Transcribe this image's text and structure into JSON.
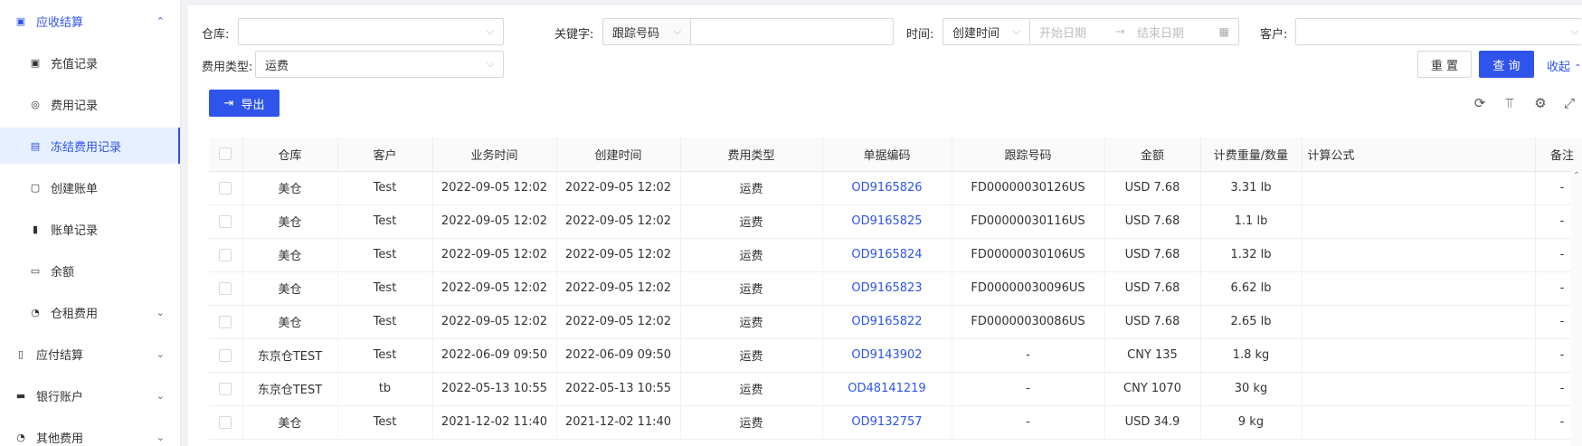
{
  "sidebar": {
    "items": [
      {
        "icon": "ticket-icon",
        "glyph": "▣",
        "label": "应收结算",
        "level": "top",
        "arrow": "⌃",
        "state": "open"
      },
      {
        "icon": "ticket-icon",
        "glyph": "▣",
        "label": "充值记录",
        "level": "sub",
        "arrow": "",
        "state": ""
      },
      {
        "icon": "coin-icon",
        "glyph": "◎",
        "label": "费用记录",
        "level": "sub",
        "arrow": "",
        "state": ""
      },
      {
        "icon": "freeze-icon",
        "glyph": "▤",
        "label": "冻结费用记录",
        "level": "sub",
        "arrow": "",
        "state": "active"
      },
      {
        "icon": "bill-icon",
        "glyph": "▢",
        "label": "创建账单",
        "level": "sub",
        "arrow": "",
        "state": ""
      },
      {
        "icon": "record-icon",
        "glyph": "▮",
        "label": "账单记录",
        "level": "sub",
        "arrow": "",
        "state": ""
      },
      {
        "icon": "balance-icon",
        "glyph": "▭",
        "label": "余额",
        "level": "sub",
        "arrow": "",
        "state": ""
      },
      {
        "icon": "rent-icon",
        "glyph": "◔",
        "label": "仓租费用",
        "level": "sub",
        "arrow": "⌄",
        "state": ""
      },
      {
        "icon": "payable-icon",
        "glyph": "▯",
        "label": "应付结算",
        "level": "top",
        "arrow": "⌄",
        "state": ""
      },
      {
        "icon": "bank-icon",
        "glyph": "▬",
        "label": "银行账户",
        "level": "top",
        "arrow": "⌄",
        "state": ""
      },
      {
        "icon": "other-fee-icon",
        "glyph": "◔",
        "label": "其他费用",
        "level": "top",
        "arrow": "⌄",
        "state": ""
      }
    ]
  },
  "filters": {
    "warehouse_label": "仓库:",
    "keyword_label": "关键字:",
    "keyword_type": "跟踪号码",
    "time_label": "时间:",
    "time_type": "创建时间",
    "start_placeholder": "开始日期",
    "end_placeholder": "结束日期",
    "date_arrow": "→",
    "customer_label": "客户:",
    "fee_type_label": "费用类型:",
    "fee_type_value": "运费",
    "reset": "重 置",
    "query": "查 询",
    "collapse": "收起"
  },
  "toolbar": {
    "export": "导出"
  },
  "table": {
    "columns": [
      "仓库",
      "客户",
      "业务时间",
      "创建时间",
      "费用类型",
      "单据编码",
      "跟踪号码",
      "金额",
      "计费重量/数量",
      "计算公式",
      "备注"
    ],
    "rows": [
      [
        "美仓",
        "Test",
        "2022-09-05 12:02",
        "2022-09-05 12:02",
        "运费",
        "OD9165826",
        "FD00000030126US",
        "USD 7.68",
        "3.31 lb",
        "",
        "-"
      ],
      [
        "美仓",
        "Test",
        "2022-09-05 12:02",
        "2022-09-05 12:02",
        "运费",
        "OD9165825",
        "FD00000030116US",
        "USD 7.68",
        "1.1 lb",
        "",
        "-"
      ],
      [
        "美仓",
        "Test",
        "2022-09-05 12:02",
        "2022-09-05 12:02",
        "运费",
        "OD9165824",
        "FD00000030106US",
        "USD 7.68",
        "1.32 lb",
        "",
        "-"
      ],
      [
        "美仓",
        "Test",
        "2022-09-05 12:02",
        "2022-09-05 12:02",
        "运费",
        "OD9165823",
        "FD00000030096US",
        "USD 7.68",
        "6.62 lb",
        "",
        "-"
      ],
      [
        "美仓",
        "Test",
        "2022-09-05 12:02",
        "2022-09-05 12:02",
        "运费",
        "OD9165822",
        "FD00000030086US",
        "USD 7.68",
        "2.65 lb",
        "",
        "-"
      ],
      [
        "东京仓TEST",
        "Test",
        "2022-06-09 09:50",
        "2022-06-09 09:50",
        "运费",
        "OD9143902",
        "-",
        "CNY 135",
        "1.8 kg",
        "",
        "-"
      ],
      [
        "东京仓TEST",
        "tb",
        "2022-05-13 10:55",
        "2022-05-13 10:55",
        "运费",
        "OD48141219",
        "-",
        "CNY 1070",
        "30 kg",
        "",
        "-"
      ],
      [
        "美仓",
        "Test",
        "2021-12-02 11:40",
        "2021-12-02 11:40",
        "运费",
        "OD9132757",
        "-",
        "USD 34.9",
        "9 kg",
        "",
        "-"
      ]
    ]
  },
  "colors": {
    "accent": "#2f54eb",
    "active_bg": "#e6f0ff"
  }
}
